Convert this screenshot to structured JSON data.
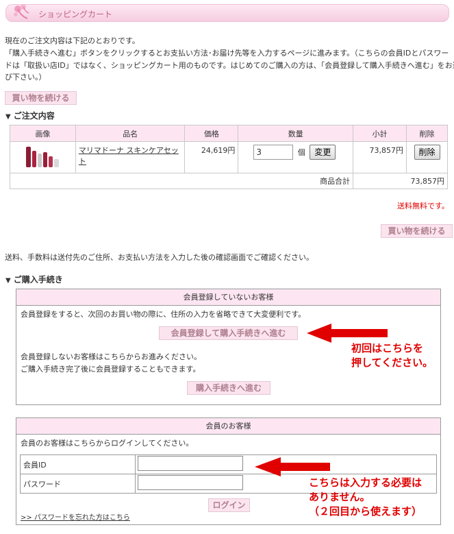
{
  "header": {
    "title": "ショッピングカート",
    "logo_icon": "flower-logo-icon"
  },
  "intro": {
    "line1": "現在のご注文内容は下記のとおりです。",
    "line2": "「購入手続きへ進む」ボタンをクリックするとお支払い方法･お届け先等を入力するページに進みます。（こちらの会員IDとパスワー",
    "line3": "ドは「取扱い店ID」ではなく、ショッピングカート用のものです。はじめてのご購入の方は、「会員登録して購入手続きへ進む」をお選",
    "line4": "び下さい。）"
  },
  "continue_shopping_label": "買い物を続ける",
  "order_section_title": "ご注文内容",
  "cart": {
    "columns": [
      "画像",
      "品名",
      "価格",
      "数量",
      "小計",
      "削除"
    ],
    "item": {
      "name": "マリマドーナ スキンケアセット",
      "price": "24,619円",
      "quantity": "3",
      "unit": "個",
      "change_label": "変更",
      "subtotal": "73,857円",
      "delete_label": "削除"
    },
    "total_label": "商品合計",
    "total_value": "73,857円"
  },
  "shipping_free": "送料無料です。",
  "fee_note": "送料、手数料は送付先のご住所、お支払い方法を入力した後の確認画面でご確認ください。",
  "purchase_section_title": "ご購入手続き",
  "guest_box": {
    "title": "会員登録していないお客様",
    "desc": "会員登録をすると、次回のお買い物の際に、住所の入力を省略できて大変便利です。",
    "register_button": "会員登録して購入手続きへ進む",
    "desc2": "会員登録しないお客様はこちらからお進みください。",
    "desc3": "ご購入手続き完了後に会員登録することもできます。",
    "purchase_button": "購入手続きへ進む"
  },
  "member_box": {
    "title": "会員のお客様",
    "desc": "会員のお客様はこちらからログインしてください。",
    "member_id_label": "会員ID",
    "password_label": "パスワード",
    "login_button": "ログイン",
    "forgot_link": ">> パスワードを忘れた方はこちら"
  },
  "annotations": {
    "note1_line1": "初回はこちらを",
    "note1_line2": "押してください。",
    "note2_line1": "こちらは入力する必要は",
    "note2_line2": "ありません。",
    "note2_line3": "（２回目から使えます）",
    "color": "#e00000"
  }
}
